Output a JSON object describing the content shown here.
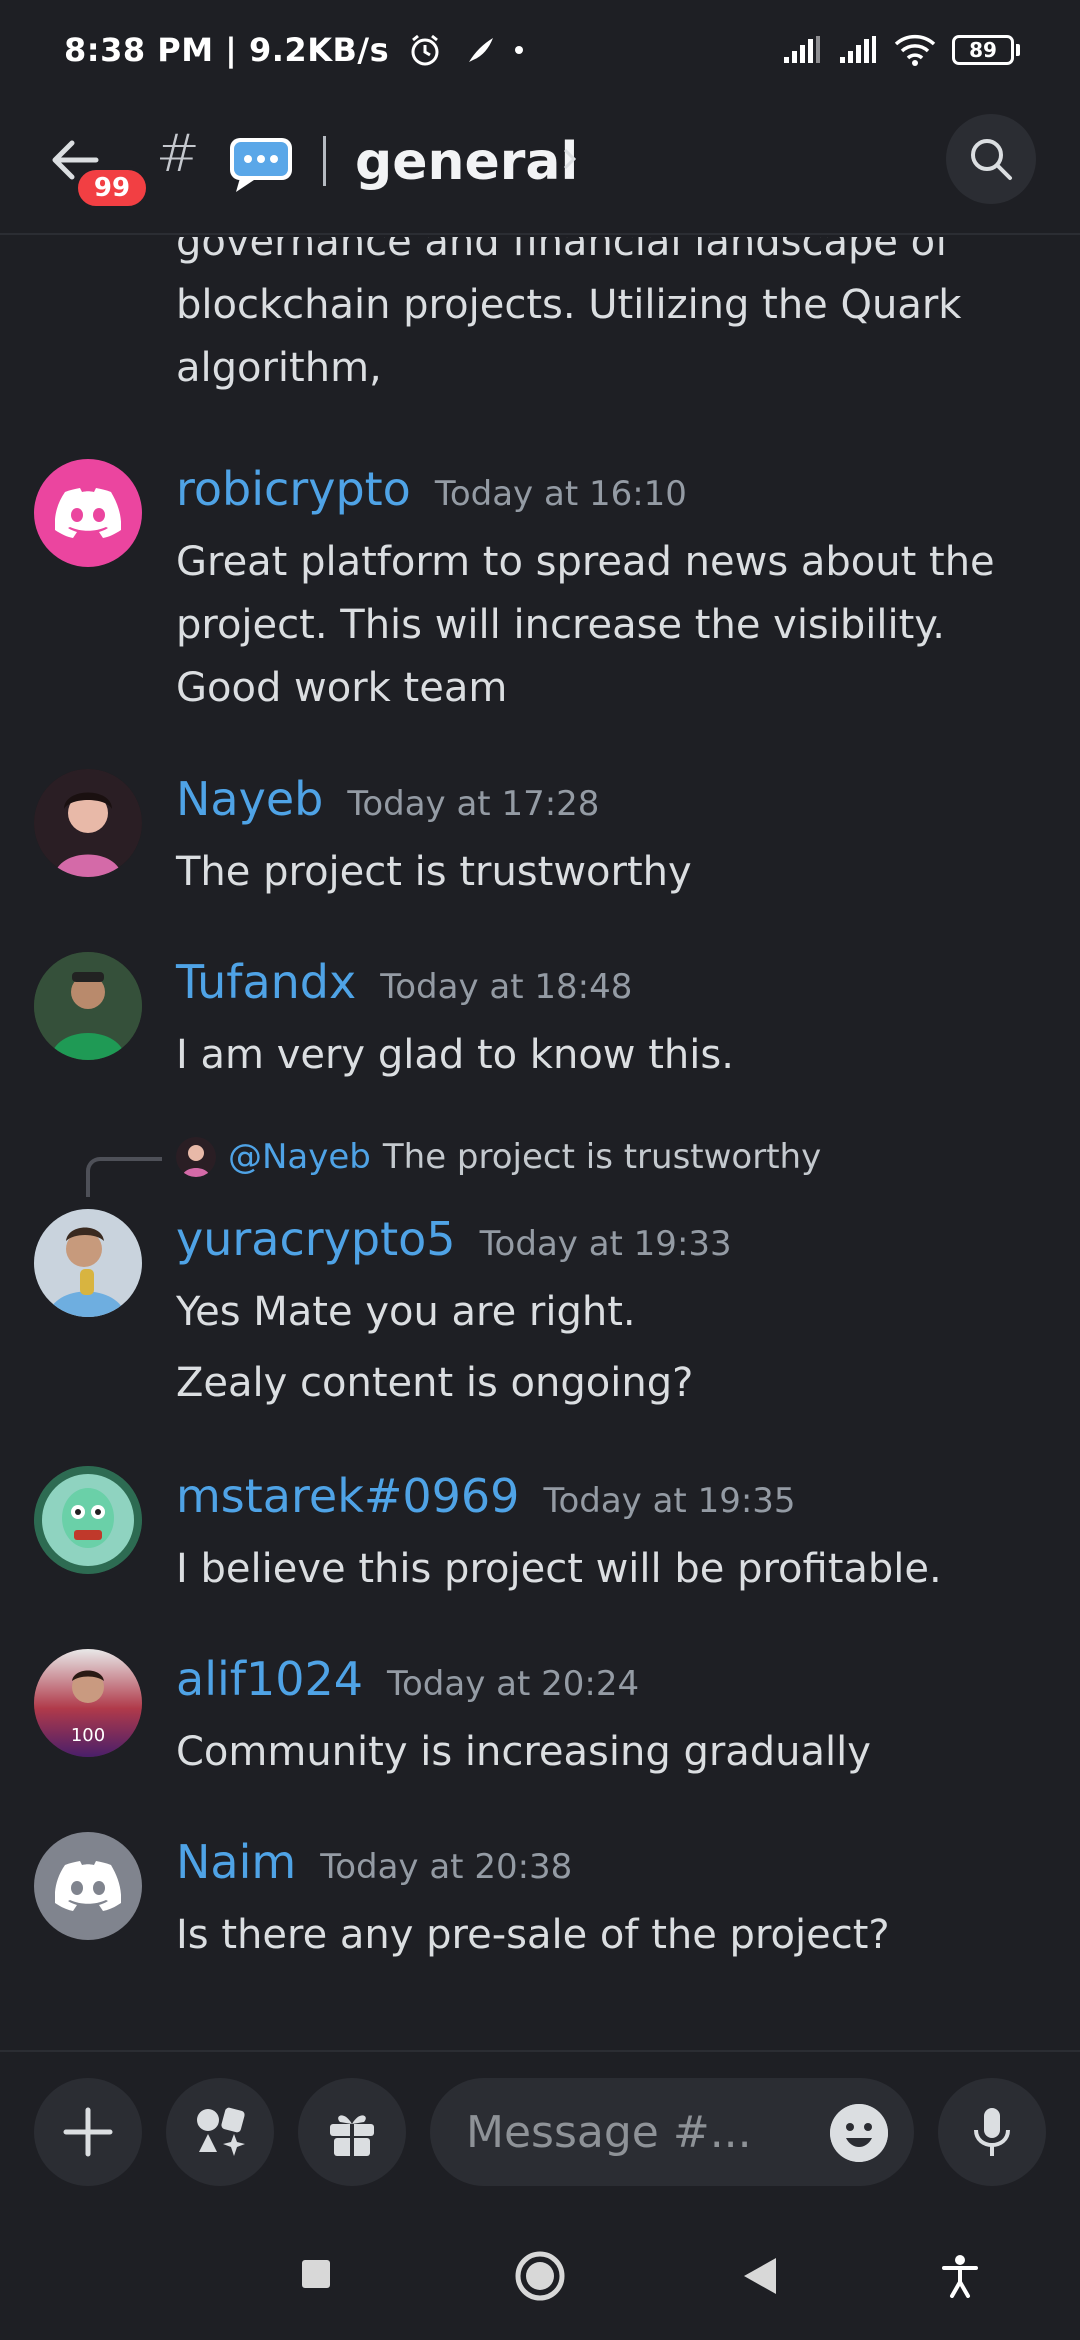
{
  "status_bar": {
    "time": "8:38 PM | 9.2KB/s",
    "battery": "89"
  },
  "header": {
    "badge_count": "99",
    "channel_name": "general"
  },
  "messages": {
    "continued_text": "governance and financial landscape of blockchain projects. Utilizing the Quark algorithm,",
    "items": [
      {
        "username": "robicrypto",
        "time": "Today at 16:10",
        "text": "Great platform to spread news about the project. This will increase the visibility. Good work team"
      },
      {
        "username": "Nayeb",
        "time": "Today at 17:28",
        "text": "The project is trustworthy"
      },
      {
        "username": "Tufandx",
        "time": "Today at 18:48",
        "text": "I am very glad to know this."
      },
      {
        "username": "yuracrypto5",
        "time": "Today at 19:33",
        "text": "Yes Mate you are right.",
        "text2": "Zealy content is ongoing?",
        "reply": {
          "mention": "@Nayeb",
          "text": "The project is trustworthy"
        }
      },
      {
        "username": "mstarek#0969",
        "time": "Today at 19:35",
        "text": "I believe this project will be profitable."
      },
      {
        "username": "alif1024",
        "time": "Today at 20:24",
        "text": "Community is increasing gradually"
      },
      {
        "username": "Naim",
        "time": "Today at 20:38",
        "text": "Is there any pre-sale of the project?"
      }
    ]
  },
  "composer": {
    "placeholder": "Message #..."
  },
  "colors": {
    "background": "#1e1f24",
    "username": "#4fa3e6",
    "discord_pink": "#eb459f",
    "discord_gray": "#80848e",
    "badge": "#f23f43"
  }
}
